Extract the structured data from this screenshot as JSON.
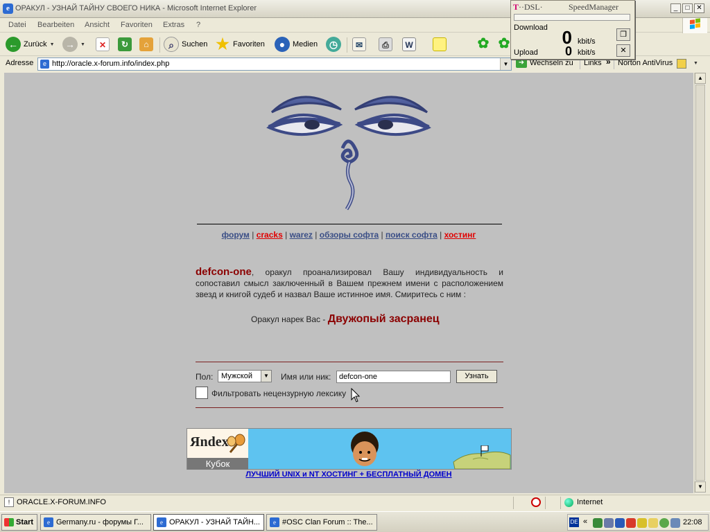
{
  "window": {
    "title": "ОРАКУЛ - УЗНАЙ ТАЙНУ СВОЕГО НИКА - Microsoft Internet Explorer"
  },
  "menu": [
    "Datei",
    "Bearbeiten",
    "Ansicht",
    "Favoriten",
    "Extras",
    "?"
  ],
  "toolbar": {
    "back": "Zurück",
    "search": "Suchen",
    "favorites": "Favoriten",
    "media": "Medien"
  },
  "address": {
    "label": "Adresse",
    "url": "http://oracle.x-forum.info/index.php",
    "go": "Wechseln zu",
    "links": "Links",
    "norton": "Norton AntiVirus"
  },
  "speed_manager": {
    "brand_t": "T",
    "brand_dsl": "··DSL·",
    "title": "SpeedManager",
    "download_label": "Download",
    "download_value": "0",
    "upload_label": "Upload",
    "upload_value": "0",
    "unit": "kbit/s"
  },
  "page": {
    "nav": [
      {
        "label": "форум",
        "color": "#3a4e86"
      },
      {
        "label": "cracks",
        "color": "#e00000"
      },
      {
        "label": "warez",
        "color": "#3a4e86"
      },
      {
        "label": "обзоры софта",
        "color": "#3a4e86"
      },
      {
        "label": "поиск софта",
        "color": "#3a4e86"
      },
      {
        "label": "хостинг",
        "color": "#e00000"
      }
    ],
    "nick": "defcon-one",
    "oracle_text": ", оракул проанализировал Вашу индивидуальность и сопоставил смысл заключенный в Вашем прежнем имени с расположением звезд и книгой судеб и назвал Ваше истинное  имя. Смиритесь с ним :",
    "verdict_prefix": "Оракул нарек Вас  - ",
    "verdict_name": "Двужопый засранец",
    "form": {
      "gender_label": "Пол:",
      "gender_value": "Мужской",
      "nick_label": "Имя или ник:",
      "nick_value": "defcon-one",
      "submit": "Узнать",
      "filter_label": "Фильтровать нецензурную лексику",
      "filter_checked": false
    },
    "banner": {
      "logo_text": "Яndex",
      "cup_label": "Кубок"
    },
    "hosting_link": "ЛУЧШИЙ UNIX и NT ХОСТИНГ + БЕСПЛАТНЫЙ ДОМЕН"
  },
  "status": {
    "text": "ORACLE.X-FORUM.INFO",
    "zone": "Internet"
  },
  "taskbar": {
    "start": "Start",
    "tasks": [
      "Germany.ru - форумы Г...",
      "ОРАКУЛ - УЗНАЙ ТАЙН...",
      "#OSC Clan Forum :: The..."
    ],
    "lang": "DE",
    "clock": "22:08"
  }
}
